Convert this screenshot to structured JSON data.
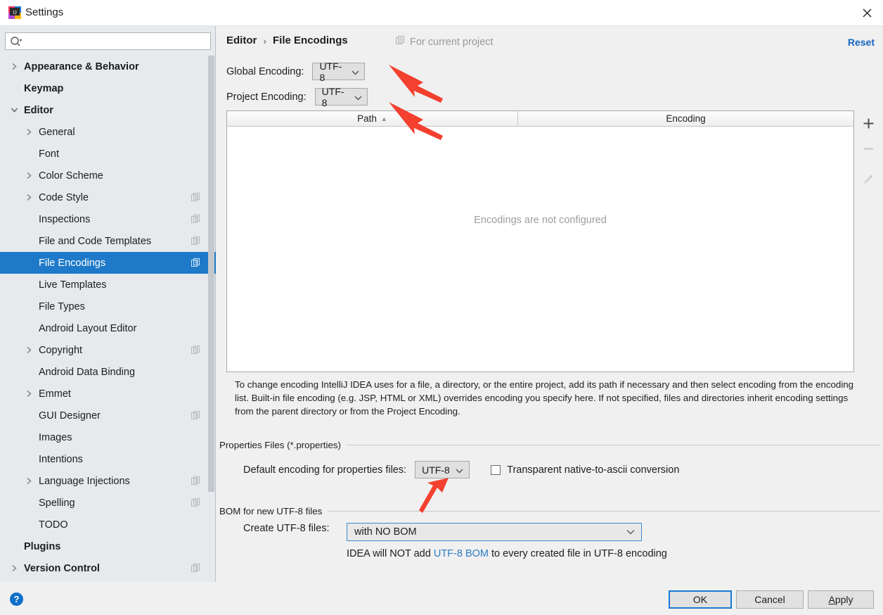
{
  "window": {
    "title": "Settings",
    "app_icon": "intellij-idea-icon",
    "close_icon": "close-icon"
  },
  "sidebar": {
    "search": {
      "placeholder": "",
      "value": "",
      "icon": "search-icon"
    },
    "items": [
      {
        "label": "Appearance & Behavior",
        "level": 0,
        "arrow": "right",
        "bold": true,
        "project_icon": false,
        "selected": false
      },
      {
        "label": "Keymap",
        "level": 0,
        "arrow": "none",
        "bold": true,
        "project_icon": false,
        "selected": false
      },
      {
        "label": "Editor",
        "level": 0,
        "arrow": "down",
        "bold": true,
        "project_icon": false,
        "selected": false
      },
      {
        "label": "General",
        "level": 1,
        "arrow": "right",
        "bold": false,
        "project_icon": false,
        "selected": false
      },
      {
        "label": "Font",
        "level": 1,
        "arrow": "none",
        "bold": false,
        "project_icon": false,
        "selected": false
      },
      {
        "label": "Color Scheme",
        "level": 1,
        "arrow": "right",
        "bold": false,
        "project_icon": false,
        "selected": false
      },
      {
        "label": "Code Style",
        "level": 1,
        "arrow": "right",
        "bold": false,
        "project_icon": true,
        "selected": false
      },
      {
        "label": "Inspections",
        "level": 1,
        "arrow": "none",
        "bold": false,
        "project_icon": true,
        "selected": false
      },
      {
        "label": "File and Code Templates",
        "level": 1,
        "arrow": "none",
        "bold": false,
        "project_icon": true,
        "selected": false
      },
      {
        "label": "File Encodings",
        "level": 1,
        "arrow": "none",
        "bold": false,
        "project_icon": true,
        "selected": true
      },
      {
        "label": "Live Templates",
        "level": 1,
        "arrow": "none",
        "bold": false,
        "project_icon": false,
        "selected": false
      },
      {
        "label": "File Types",
        "level": 1,
        "arrow": "none",
        "bold": false,
        "project_icon": false,
        "selected": false
      },
      {
        "label": "Android Layout Editor",
        "level": 1,
        "arrow": "none",
        "bold": false,
        "project_icon": false,
        "selected": false
      },
      {
        "label": "Copyright",
        "level": 1,
        "arrow": "right",
        "bold": false,
        "project_icon": true,
        "selected": false
      },
      {
        "label": "Android Data Binding",
        "level": 1,
        "arrow": "none",
        "bold": false,
        "project_icon": false,
        "selected": false
      },
      {
        "label": "Emmet",
        "level": 1,
        "arrow": "right",
        "bold": false,
        "project_icon": false,
        "selected": false
      },
      {
        "label": "GUI Designer",
        "level": 1,
        "arrow": "none",
        "bold": false,
        "project_icon": true,
        "selected": false
      },
      {
        "label": "Images",
        "level": 1,
        "arrow": "none",
        "bold": false,
        "project_icon": false,
        "selected": false
      },
      {
        "label": "Intentions",
        "level": 1,
        "arrow": "none",
        "bold": false,
        "project_icon": false,
        "selected": false
      },
      {
        "label": "Language Injections",
        "level": 1,
        "arrow": "right",
        "bold": false,
        "project_icon": true,
        "selected": false
      },
      {
        "label": "Spelling",
        "level": 1,
        "arrow": "none",
        "bold": false,
        "project_icon": true,
        "selected": false
      },
      {
        "label": "TODO",
        "level": 1,
        "arrow": "none",
        "bold": false,
        "project_icon": false,
        "selected": false
      },
      {
        "label": "Plugins",
        "level": 0,
        "arrow": "none",
        "bold": true,
        "project_icon": false,
        "selected": false
      },
      {
        "label": "Version Control",
        "level": 0,
        "arrow": "right",
        "bold": true,
        "project_icon": true,
        "selected": false
      }
    ]
  },
  "main": {
    "breadcrumb": {
      "parent": "Editor",
      "separator": "›",
      "current": "File Encodings"
    },
    "for_current_project": {
      "label": "For current project",
      "icon": "project-scope-icon"
    },
    "reset_label": "Reset",
    "global_encoding": {
      "label": "Global Encoding:",
      "value": "UTF-8"
    },
    "project_encoding": {
      "label": "Project Encoding:",
      "value": "UTF-8"
    },
    "table": {
      "columns": [
        "Path",
        "Encoding"
      ],
      "sort_column": "Path",
      "sort_direction": "ascending",
      "rows": [],
      "empty_text": "Encodings are not configured",
      "tools": [
        {
          "name": "add-button",
          "glyph": "+",
          "enabled": true
        },
        {
          "name": "remove-button",
          "glyph": "−",
          "enabled": false
        },
        {
          "name": "edit-button",
          "glyph": "pencil",
          "enabled": false
        }
      ]
    },
    "description": "To change encoding IntelliJ IDEA uses for a file, a directory, or the entire project, add its path if necessary and then select encoding from the encoding list. Built-in file encoding (e.g. JSP, HTML or XML) overrides encoding you specify here. If not specified, files and directories inherit encoding settings from the parent directory or from the Project Encoding.",
    "properties_group": {
      "title": "Properties Files (*.properties)",
      "default_encoding_label": "Default encoding for properties files:",
      "default_encoding_value": "UTF-8",
      "transparent_checkbox_label": "Transparent native-to-ascii conversion",
      "transparent_checked": false
    },
    "bom_group": {
      "title": "BOM for new UTF-8 files",
      "create_label": "Create UTF-8 files:",
      "create_value": "with NO BOM",
      "hint_before": "IDEA will NOT add ",
      "hint_link": "UTF-8 BOM",
      "hint_after": " to every created file in UTF-8 encoding"
    }
  },
  "footer": {
    "help_label": "?",
    "ok_label": "OK",
    "cancel_label": "Cancel",
    "apply_label_prefix": "A",
    "apply_label_rest": "pply"
  },
  "colors": {
    "accent_blue": "#1e7ac8",
    "link_blue": "#1565c0",
    "annotation_red": "#f4402f",
    "sidebar_bg": "#e6eaed",
    "panel_bg": "#f0f0f0"
  }
}
